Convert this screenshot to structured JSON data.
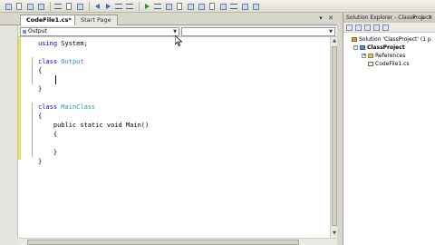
{
  "toolbar": {
    "icons": [
      "new-project-icon",
      "open-icon",
      "save-icon",
      "save-all-icon",
      "cut-icon",
      "copy-icon",
      "paste-icon",
      "undo-icon",
      "redo-icon",
      "navigate-back-icon",
      "navigate-forward-icon",
      "start-debug-icon",
      "find-icon",
      "solution-explorer-icon",
      "properties-icon",
      "toolbox-icon",
      "object-browser-icon",
      "start-page-icon",
      "output-icon",
      "error-list-icon",
      "comment-icon",
      "uncomment-icon"
    ]
  },
  "tabs": [
    {
      "label": "CodeFile1.cs*",
      "active": true
    },
    {
      "label": "Start Page",
      "active": false
    }
  ],
  "editor": {
    "type_dropdown": "Output",
    "member_dropdown": "",
    "code_lines": [
      [
        {
          "t": "using",
          "k": "kw"
        },
        {
          "t": " System;",
          "k": ""
        }
      ],
      [
        {
          "t": "",
          "k": ""
        }
      ],
      [
        {
          "t": "class",
          "k": "kw"
        },
        {
          "t": " ",
          "k": ""
        },
        {
          "t": "Output",
          "k": "ty"
        }
      ],
      [
        {
          "t": "{",
          "k": ""
        }
      ],
      [
        {
          "t": "",
          "k": ""
        }
      ],
      [
        {
          "t": "}",
          "k": ""
        }
      ],
      [
        {
          "t": "",
          "k": ""
        }
      ],
      [
        {
          "t": "class",
          "k": "kw"
        },
        {
          "t": " ",
          "k": ""
        },
        {
          "t": "MainClass",
          "k": "ty"
        }
      ],
      [
        {
          "t": "{",
          "k": ""
        }
      ],
      [
        {
          "t": "    public static void Main()",
          "k": ""
        }
      ],
      [
        {
          "t": "    {",
          "k": ""
        }
      ],
      [
        {
          "t": "",
          "k": ""
        }
      ],
      [
        {
          "t": "    }",
          "k": ""
        }
      ],
      [
        {
          "t": "}",
          "k": ""
        }
      ]
    ]
  },
  "solution_explorer": {
    "title": "Solution Explorer - ClassProject",
    "tree": [
      {
        "label": "Solution 'ClassProject' (1 p",
        "indent": 0,
        "icon": "solution-icon",
        "expander": ""
      },
      {
        "label": "ClassProject",
        "indent": 1,
        "icon": "project-icon",
        "expander": "-",
        "bold": true
      },
      {
        "label": "References",
        "indent": 2,
        "icon": "references-icon",
        "expander": "+"
      },
      {
        "label": "CodeFile1.cs",
        "indent": 2,
        "icon": "code-file-icon",
        "expander": ""
      }
    ]
  },
  "colors": {
    "keyword": "#0000ff",
    "type": "#2b91af",
    "change_margin": "#e8e060"
  }
}
